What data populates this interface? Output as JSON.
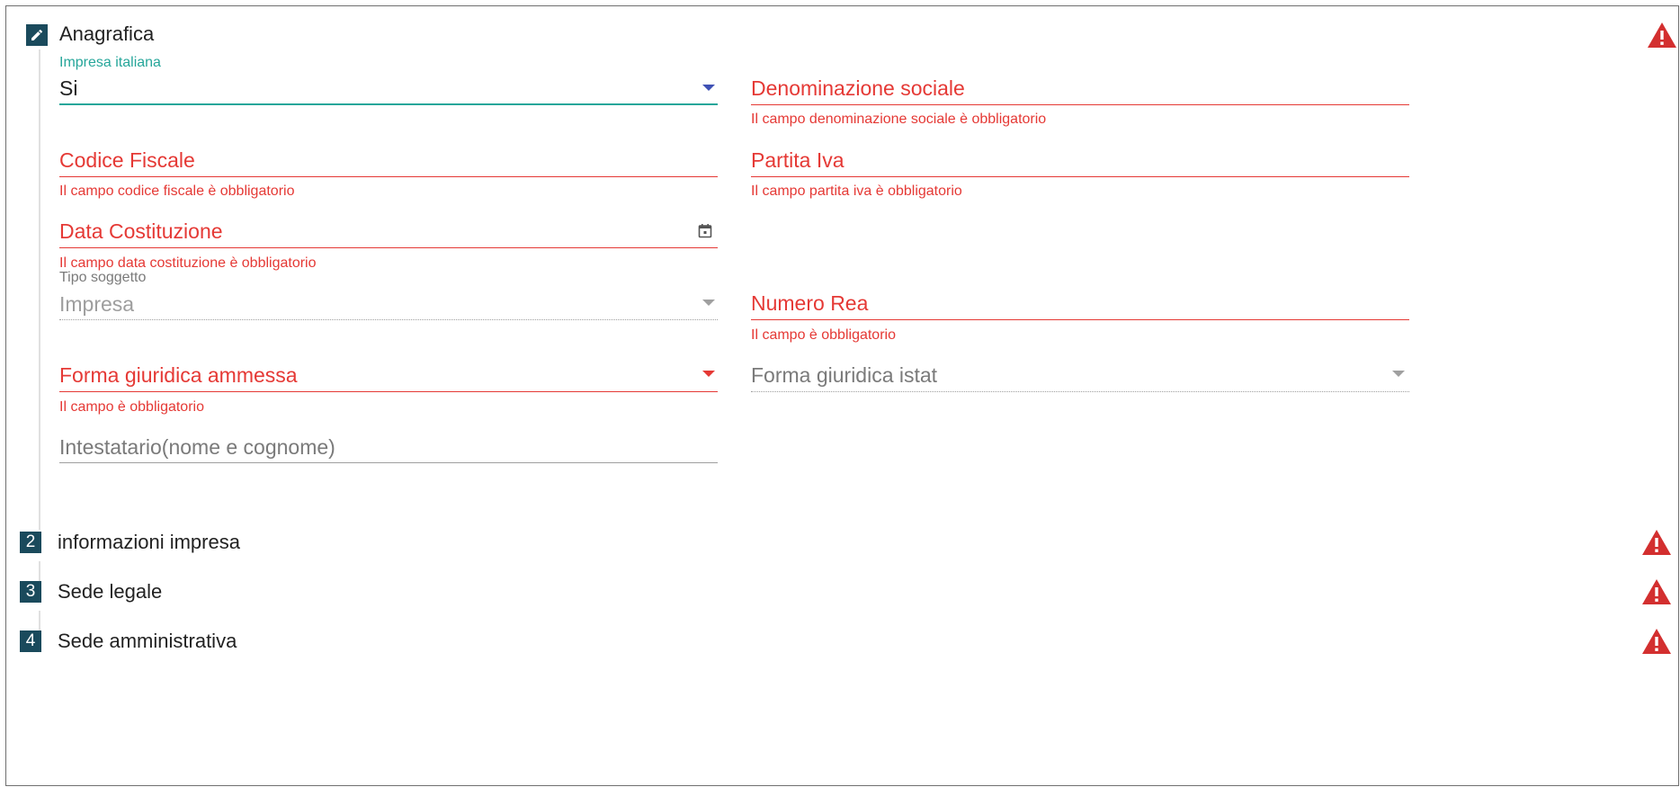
{
  "colors": {
    "step_badge": "#1a4a5c",
    "error": "#e53935",
    "teal_accent": "#26a69a",
    "select_arrow_active": "#3f51b5",
    "disabled_text": "#9e9e9e"
  },
  "steps": [
    {
      "number": "",
      "icon": "pencil-icon",
      "title": "Anagrafica",
      "status_icon": "warning-icon"
    },
    {
      "number": "2",
      "title": "informazioni impresa",
      "status_icon": "warning-icon"
    },
    {
      "number": "3",
      "title": "Sede legale",
      "status_icon": "warning-icon"
    },
    {
      "number": "4",
      "title": "Sede amministrativa",
      "status_icon": "warning-icon"
    }
  ],
  "form": {
    "impresa_italiana": {
      "label": "Impresa italiana",
      "value": "Si"
    },
    "denominazione": {
      "label": "Denominazione sociale",
      "error": "Il campo denominazione sociale è obbligatorio"
    },
    "codice_fiscale": {
      "label": "Codice Fiscale",
      "error": "Il campo codice fiscale è obbligatorio"
    },
    "partita_iva": {
      "label": "Partita Iva",
      "error": "Il campo partita iva è obbligatorio"
    },
    "data_costituzione": {
      "label": "Data Costituzione",
      "error": "Il campo data costituzione è obbligatorio",
      "icon": "calendar-icon"
    },
    "tipo_soggetto": {
      "label": "Tipo soggetto",
      "value": "Impresa"
    },
    "numero_rea": {
      "label": "Numero Rea",
      "error": "Il campo è obbligatorio"
    },
    "forma_giuridica_ammessa": {
      "label": "Forma giuridica ammessa",
      "error": "Il campo è obbligatorio"
    },
    "forma_giuridica_istat": {
      "label": "Forma giuridica istat"
    },
    "intestatario": {
      "placeholder": "Intestatario(nome e cognome)"
    }
  }
}
